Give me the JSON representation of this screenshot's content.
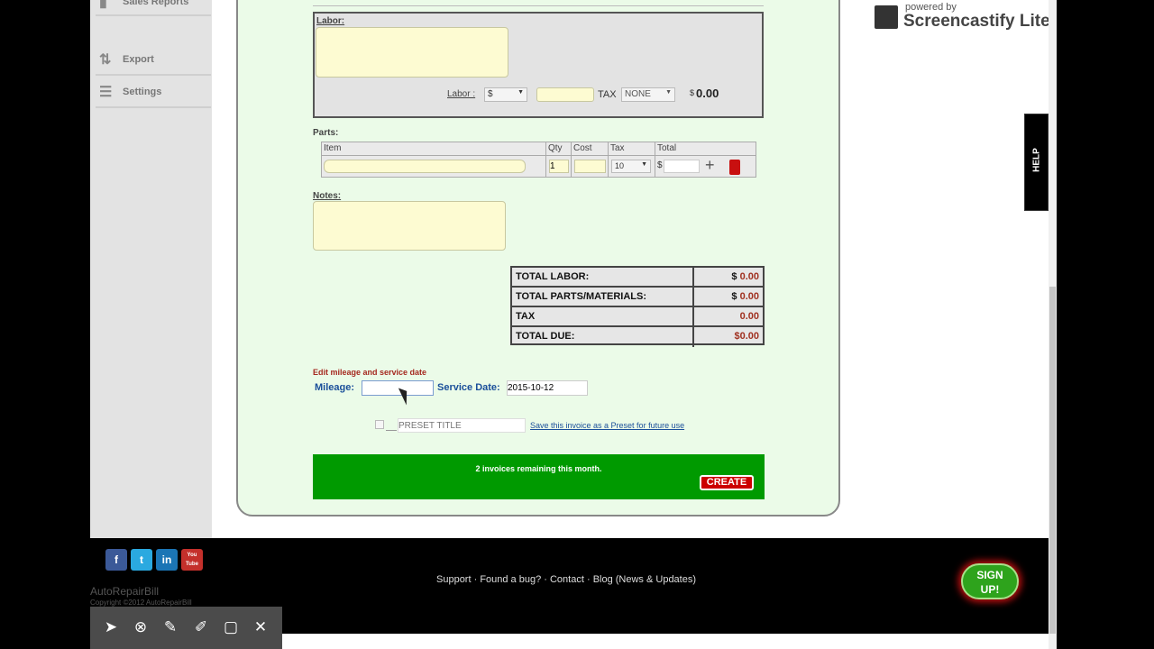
{
  "sidebar": {
    "items": [
      {
        "label": "Sales Reports",
        "icon": "bar-chart-icon"
      },
      {
        "label": "Export",
        "icon": "export-icon"
      },
      {
        "label": "Settings",
        "icon": "sliders-icon"
      }
    ]
  },
  "labor": {
    "heading": "Labor:",
    "rate_label": "Labor :",
    "rate_unit": "$",
    "tax_label": "TAX",
    "tax_value": "NONE",
    "currency": "$",
    "amount": "0.00"
  },
  "parts": {
    "heading": "Parts:",
    "columns": [
      "Item",
      "Qty",
      "Cost",
      "Tax",
      "Total"
    ],
    "row": {
      "qty": "1",
      "tax": "10",
      "currency": "$"
    }
  },
  "notes": {
    "heading": "Notes:"
  },
  "totals": [
    {
      "label": "TOTAL LABOR:",
      "currency": "$",
      "value": "0.00"
    },
    {
      "label": "TOTAL PARTS/MATERIALS:",
      "currency": "$",
      "value": "0.00"
    },
    {
      "label": "TAX",
      "currency": "",
      "value": "0.00"
    },
    {
      "label": "TOTAL DUE:",
      "currency": "",
      "value": "$0.00"
    }
  ],
  "service": {
    "edit_link": "Edit mileage and service date",
    "mileage_label": "Mileage:",
    "mileage_value": "",
    "date_label": "Service Date:",
    "date_value": "2015-10-12"
  },
  "preset": {
    "placeholder": "PRESET TITLE",
    "link": "Save this invoice as a Preset for future use"
  },
  "create_bar": {
    "message": "2 invoices remaining this month.",
    "button": "CREATE"
  },
  "footer": {
    "links": [
      "Support",
      "Found a bug?",
      "Contact",
      "Blog (News & Updates)"
    ],
    "separator": " · ",
    "brand": "AutoRepairBill",
    "copyright": "Copyright ©2012 AutoRepairBill",
    "signup": "SIGN UP!",
    "social": [
      "f",
      "t",
      "in",
      "You Tube"
    ]
  },
  "help_tab": "HELP",
  "watermark": {
    "line1": "powered by",
    "line2": "Screencastify Lite"
  },
  "colors": {
    "green_bar": "#009a00",
    "create_button": "#cc0000",
    "label_blue": "#1a4f9a",
    "input_yellow": "#fdfbd2"
  }
}
